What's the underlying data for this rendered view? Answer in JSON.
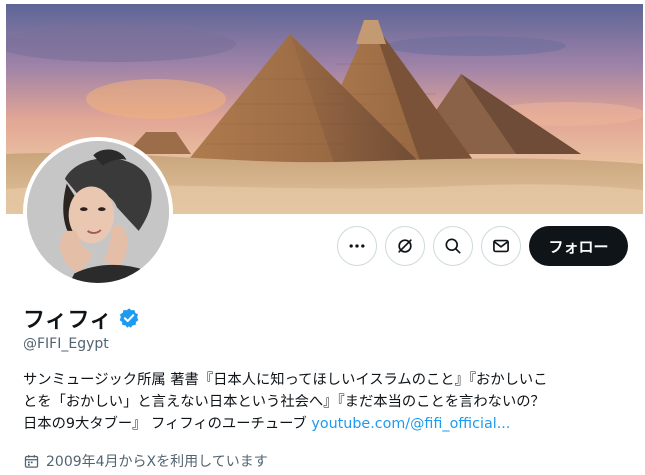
{
  "profile": {
    "display_name": "フィフィ",
    "handle": "@FIFI_Egypt",
    "verified": true,
    "bio_lines": [
      "サンミュージック所属 著書『日本人に知ってほしいイスラムのこと』『おかしいこ",
      "とを「おかしい」と言えない日本という社会へ』『まだ本当のことを言わないの？",
      "日本の9大タブー』 フィフィのユーチューブ "
    ],
    "bio_link": "youtube.com/@fifi_official...",
    "joined": "2009年4月からXを利用しています"
  },
  "actions": {
    "more_icon": "more-horizontal-icon",
    "grok_icon": "grok-icon",
    "search_icon": "search-icon",
    "message_icon": "envelope-icon",
    "follow_label": "フォロー"
  },
  "colors": {
    "accent": "#1d9bf0",
    "text": "#0f1419",
    "secondary": "#536471",
    "follow_bg": "#0f1419",
    "border": "#cfd9de"
  }
}
